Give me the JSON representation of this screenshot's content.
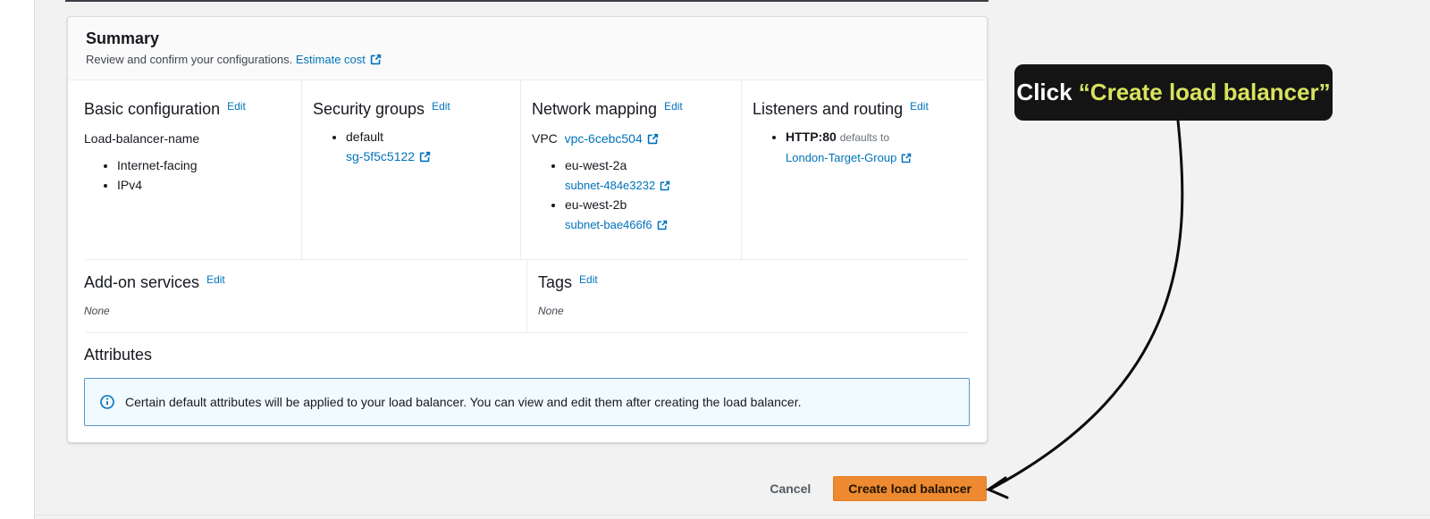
{
  "colors": {
    "accent_blue": "#0073bb",
    "primary_button_bg": "#ee8a31",
    "primary_button_text": "#1f1300",
    "cancel_text": "#545b64",
    "tooltip_bg": "#141414",
    "tooltip_highlight": "#d7e35f",
    "banner_bg": "#f1faff",
    "banner_border": "#5a95c5",
    "page_bg": "#f2f2f2"
  },
  "panel": {
    "header": {
      "title": "Summary",
      "subtitle": "Review and confirm your configurations.",
      "estimate_cost_link": "Estimate cost"
    },
    "basic_configuration": {
      "title": "Basic configuration",
      "edit_label": "Edit",
      "name": "Load-balancer-name",
      "items": [
        "Internet-facing",
        "IPv4"
      ]
    },
    "security_groups": {
      "title": "Security groups",
      "edit_label": "Edit",
      "group_name": "default",
      "group_link": "sg-5f5c5122"
    },
    "network_mapping": {
      "title": "Network mapping",
      "edit_label": "Edit",
      "vpc_label": "VPC",
      "vpc_link": "vpc-6cebc504",
      "subnets": [
        {
          "az": "eu-west-2a",
          "subnet_link": "subnet-484e3232"
        },
        {
          "az": "eu-west-2b",
          "subnet_link": "subnet-bae466f6"
        }
      ]
    },
    "listeners_routing": {
      "title": "Listeners and routing",
      "edit_label": "Edit",
      "listener": "HTTP:80",
      "connector": "defaults to",
      "target_link": "London-Target-Group"
    },
    "addon_services": {
      "title": "Add-on services",
      "edit_label": "Edit",
      "value": "None"
    },
    "tags": {
      "title": "Tags",
      "edit_label": "Edit",
      "value": "None"
    },
    "attributes": {
      "title": "Attributes",
      "info_message": "Certain default attributes will be applied to your load balancer. You can view and edit them after creating the load balancer."
    }
  },
  "footer": {
    "cancel_label": "Cancel",
    "create_label": "Create load balancer"
  },
  "annotation": {
    "prefix": "Click ",
    "quoted": "“Create load balancer”"
  }
}
